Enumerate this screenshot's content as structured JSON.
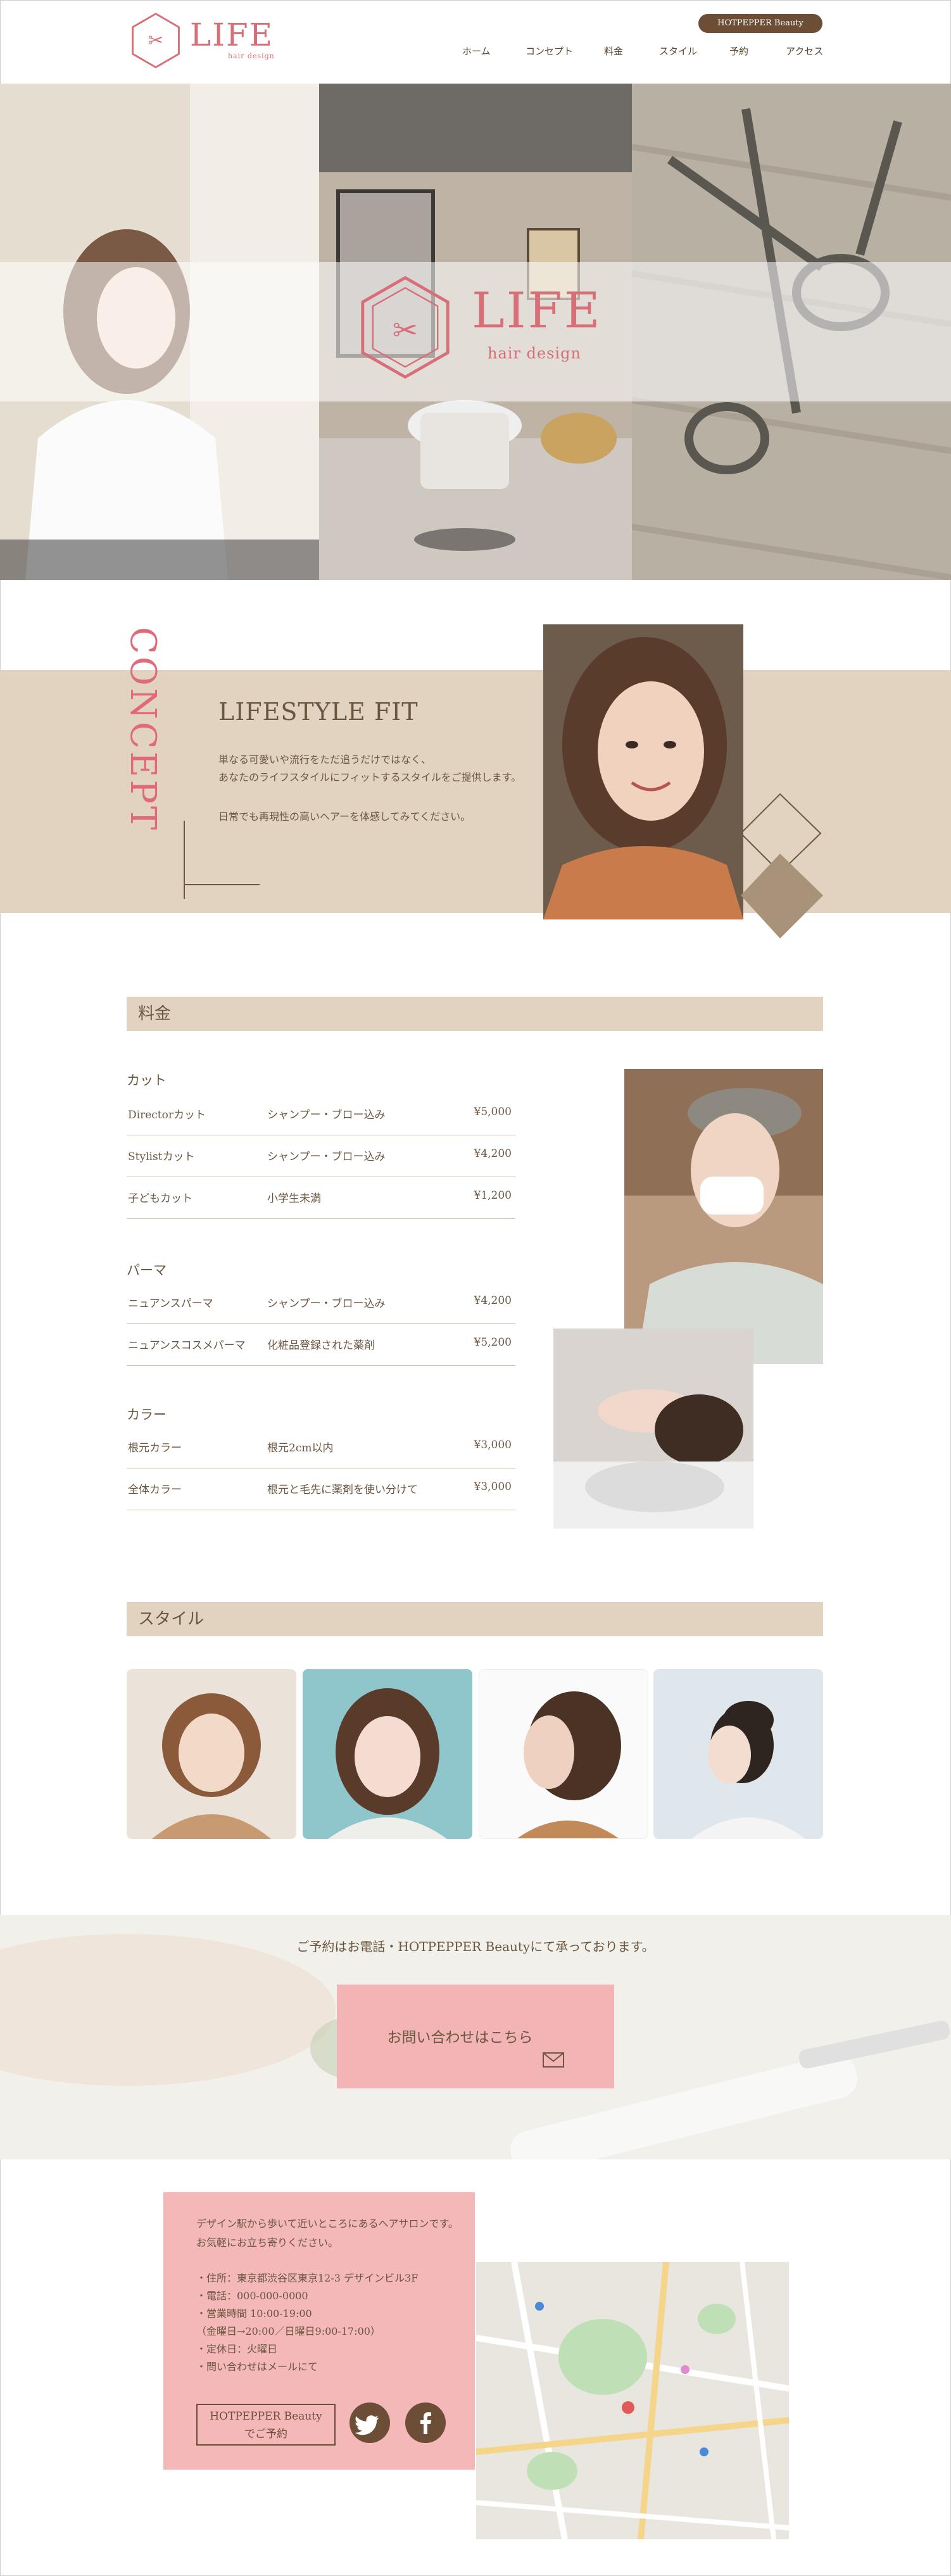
{
  "header": {
    "logo_main": "LIFE",
    "logo_sub": "hair design",
    "hotpepper_btn": "HOTPEPPER Beauty",
    "nav": [
      "ホーム",
      "コンセプト",
      "料金",
      "スタイル",
      "予約",
      "アクセス"
    ]
  },
  "hero": {
    "logo_main": "LIFE",
    "logo_sub": "hair design"
  },
  "concept": {
    "vertical_title": "CONCEPT",
    "title": "LIFESTYLE FIT",
    "line1": "単なる可愛いや流行をただ追うだけではなく、",
    "line2": "あなたのライフスタイルにフィットするスタイルをご提供します。",
    "line3": "日常でも再現性の高いヘアーを体感してみてください。"
  },
  "price": {
    "heading": "料金",
    "groups": [
      {
        "category": "カット",
        "rows": [
          {
            "name": "Directorカット",
            "note": "シャンプー・ブロー込み",
            "price": "¥5,000"
          },
          {
            "name": "Stylistカット",
            "note": "シャンプー・ブロー込み",
            "price": "¥4,200"
          },
          {
            "name": "子どもカット",
            "note": "小学生未満",
            "price": "¥1,200"
          }
        ]
      },
      {
        "category": "パーマ",
        "rows": [
          {
            "name": "ニュアンスパーマ",
            "note": "シャンプー・ブロー込み",
            "price": "¥4,200"
          },
          {
            "name": "ニュアンスコスメパーマ",
            "note": "化粧品登録された薬剤",
            "price": "¥5,200"
          }
        ]
      },
      {
        "category": "カラー",
        "rows": [
          {
            "name": "根元カラー",
            "note": "根元2cm以内",
            "price": "¥3,000"
          },
          {
            "name": "全体カラー",
            "note": "根元と毛先に薬剤を使い分けて",
            "price": "¥3,000"
          }
        ]
      }
    ]
  },
  "style": {
    "heading": "スタイル"
  },
  "booking": {
    "text": "ご予約はお電話・HOTPEPPER Beautyにて承っております。",
    "contact_btn": "お問い合わせはこちら"
  },
  "info": {
    "intro1": "デザイン駅から歩いて近いところにあるヘアサロンです。",
    "intro2": "お気軽にお立ち寄りください。",
    "address": "・住所：東京都渋谷区東京12-3 デザインビル3F",
    "phone": "・電話：000-000-0000",
    "hours": "・営業時間 10:00-19:00",
    "hours2": "（金曜日→20:00／日曜日9:00-17:00）",
    "holiday": "・定休日：火曜日",
    "inquiry": "・問い合わせはメールにて",
    "hp_btn_line1": "HOTPEPPER Beauty",
    "hp_btn_line2": "でご予約"
  },
  "colors": {
    "accent_pink": "#e06a77",
    "beige": "#e2d3c1",
    "brown": "#6b4e35",
    "pink_panel": "#f4b8b8"
  }
}
